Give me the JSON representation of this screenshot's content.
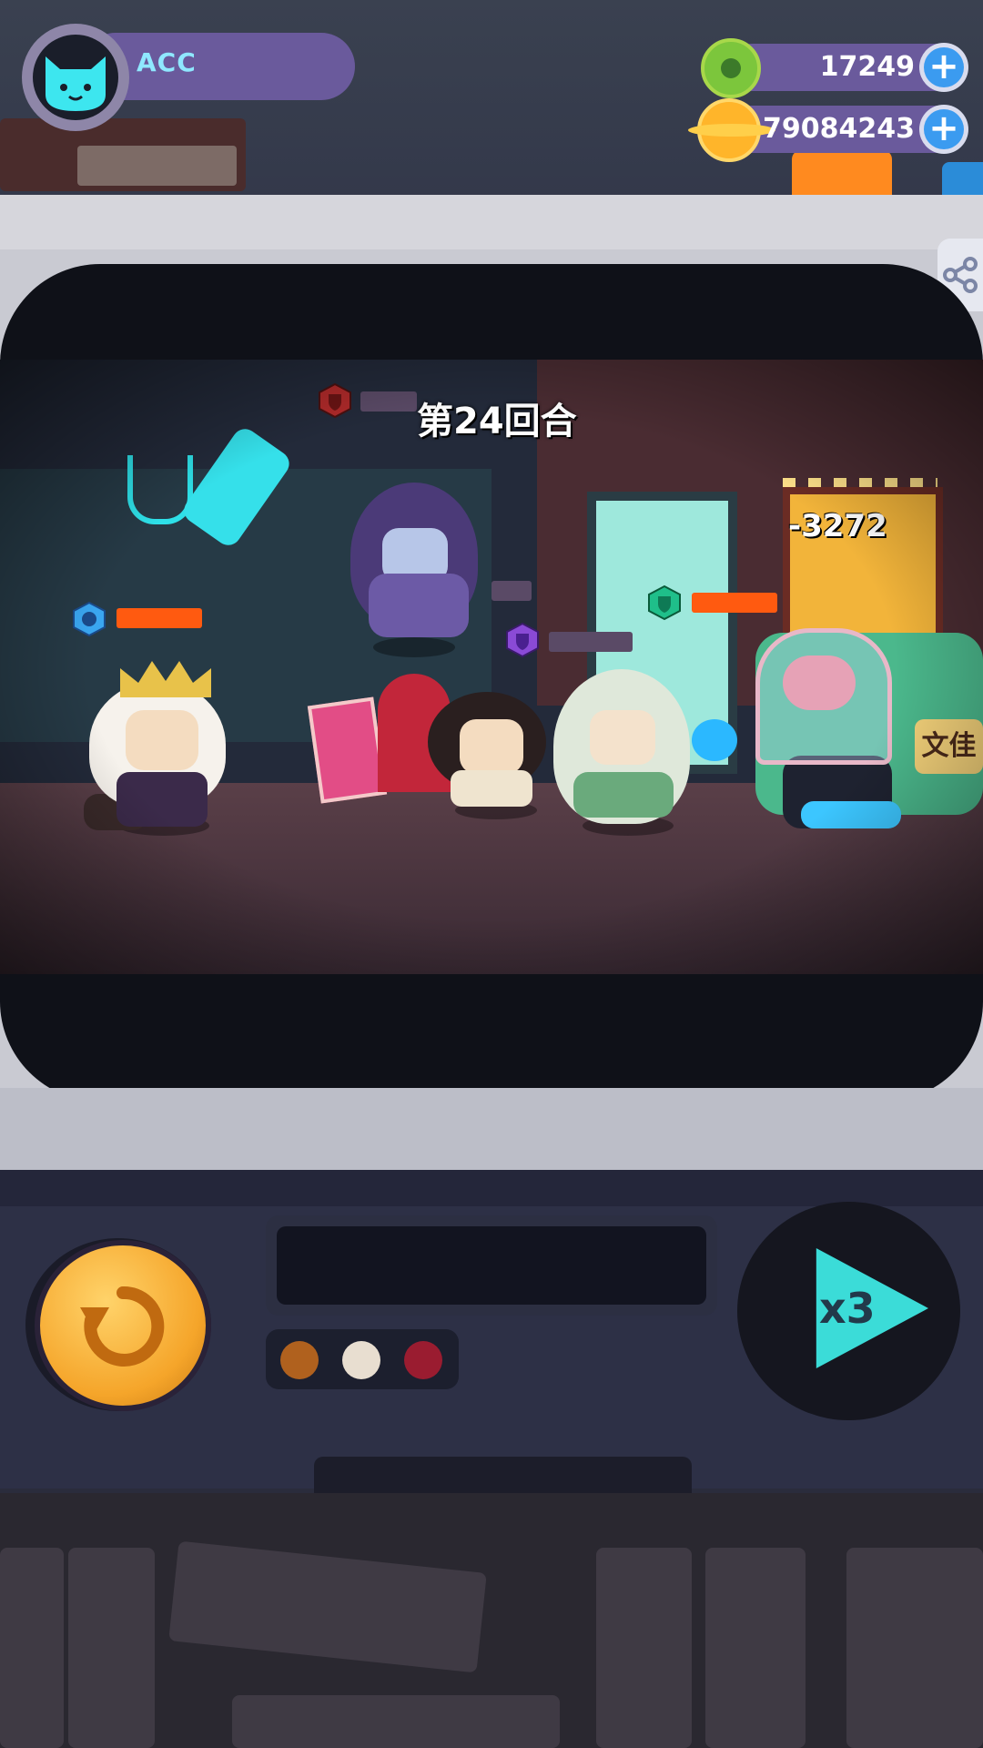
{
  "player": {
    "name": "ACC",
    "avatar_icon": "cat-face-icon"
  },
  "resources": {
    "gems": {
      "value": "17249",
      "icon": "donut-gem-icon"
    },
    "coins": {
      "value": "79084243",
      "icon": "planet-coin-icon"
    },
    "add_symbol": "+"
  },
  "battle": {
    "round_label": "第24回合",
    "damage_popup": "-3272",
    "shop_sign": "文佳"
  },
  "controls": {
    "replay_icon": "replay-icon",
    "speed_label": "x3",
    "speed_icon": "play-icon"
  },
  "indicator_lights": [
    "#b0611e",
    "#e8ded0",
    "#9a1c30"
  ],
  "colors": {
    "accent_purple": "#6a5a9c",
    "hp_orange": "#ff5a10",
    "neon_cyan": "#3bdcd8",
    "button_gold": "#f5a52a"
  }
}
